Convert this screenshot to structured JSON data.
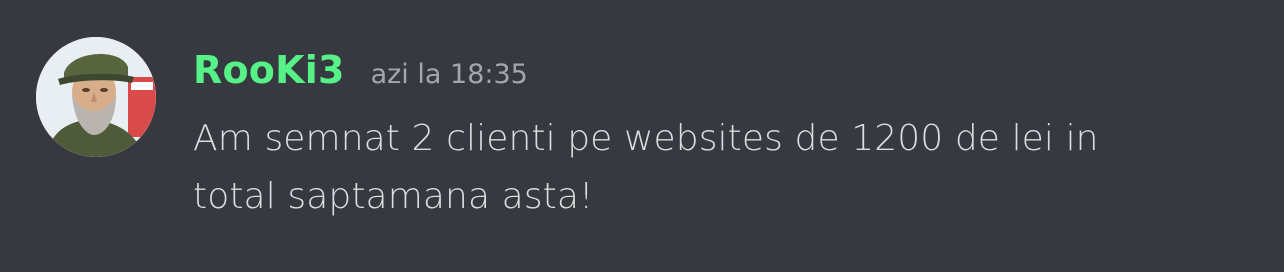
{
  "message": {
    "author": {
      "username": "RooKi3",
      "name_color": "#57f287"
    },
    "timestamp": "azi la 18:35",
    "content_lines": [
      "Am semnat 2 clienti pe websites de 1200 de lei in",
      "total saptamana asta!"
    ]
  },
  "colors": {
    "background": "#36393f",
    "text": "#dcddde",
    "muted": "#a3a6aa"
  }
}
